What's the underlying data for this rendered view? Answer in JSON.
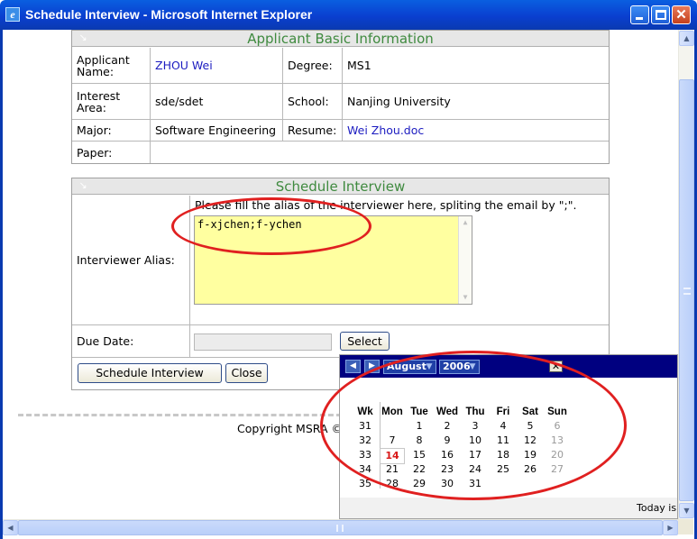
{
  "window": {
    "title": "Schedule Interview - Microsoft Internet Explorer",
    "app_icon_glyph": "e"
  },
  "applicant": {
    "heading": "Applicant Basic Information",
    "name_label": "Applicant Name:",
    "name_value": "ZHOU Wei",
    "degree_label": "Degree:",
    "degree_value": "MS1",
    "interest_label": "Interest Area:",
    "interest_value": "sde/sdet",
    "school_label": "School:",
    "school_value": "Nanjing University",
    "major_label": "Major:",
    "major_value": "Software Engineering",
    "resume_label": "Resume:",
    "resume_value": "Wei Zhou.doc",
    "paper_label": "Paper:",
    "paper_value": ""
  },
  "schedule": {
    "heading": "Schedule Interview",
    "alias_label": "Interviewer Alias:",
    "alias_hint": "Please fill the alias of the interviewer here, spliting the email by \";\".",
    "alias_value": "f-xjchen;f-ychen",
    "due_label": "Due Date:",
    "due_value": "",
    "select_button": "Select",
    "schedule_button": "Schedule Interview",
    "close_button": "Close"
  },
  "footer": {
    "copyright": "Copyright MSRA ©"
  },
  "calendar": {
    "month": "August",
    "year": "2006",
    "close_glyph": "✕",
    "headers": [
      "Wk",
      "Mon",
      "Tue",
      "Wed",
      "Thu",
      "Fri",
      "Sat",
      "Sun"
    ],
    "weeks": [
      {
        "wk": "31",
        "days": [
          "",
          "1",
          "2",
          "3",
          "4",
          "5",
          "6"
        ]
      },
      {
        "wk": "32",
        "days": [
          "7",
          "8",
          "9",
          "10",
          "11",
          "12",
          "13"
        ]
      },
      {
        "wk": "33",
        "days": [
          "14",
          "15",
          "16",
          "17",
          "18",
          "19",
          "20"
        ]
      },
      {
        "wk": "34",
        "days": [
          "21",
          "22",
          "23",
          "24",
          "25",
          "26",
          "27"
        ]
      },
      {
        "wk": "35",
        "days": [
          "28",
          "29",
          "30",
          "31",
          "",
          "",
          ""
        ]
      }
    ],
    "today": "14",
    "footer_text": "Today is"
  },
  "colors": {
    "titlebar": "#0a3fd0",
    "heading_green": "#3f8a3f",
    "link_blue": "#1c1cc0",
    "alias_bg": "#ffffa0",
    "calendar_header": "#000080",
    "annotation_red": "#e02020",
    "today_red": "#d81818"
  }
}
